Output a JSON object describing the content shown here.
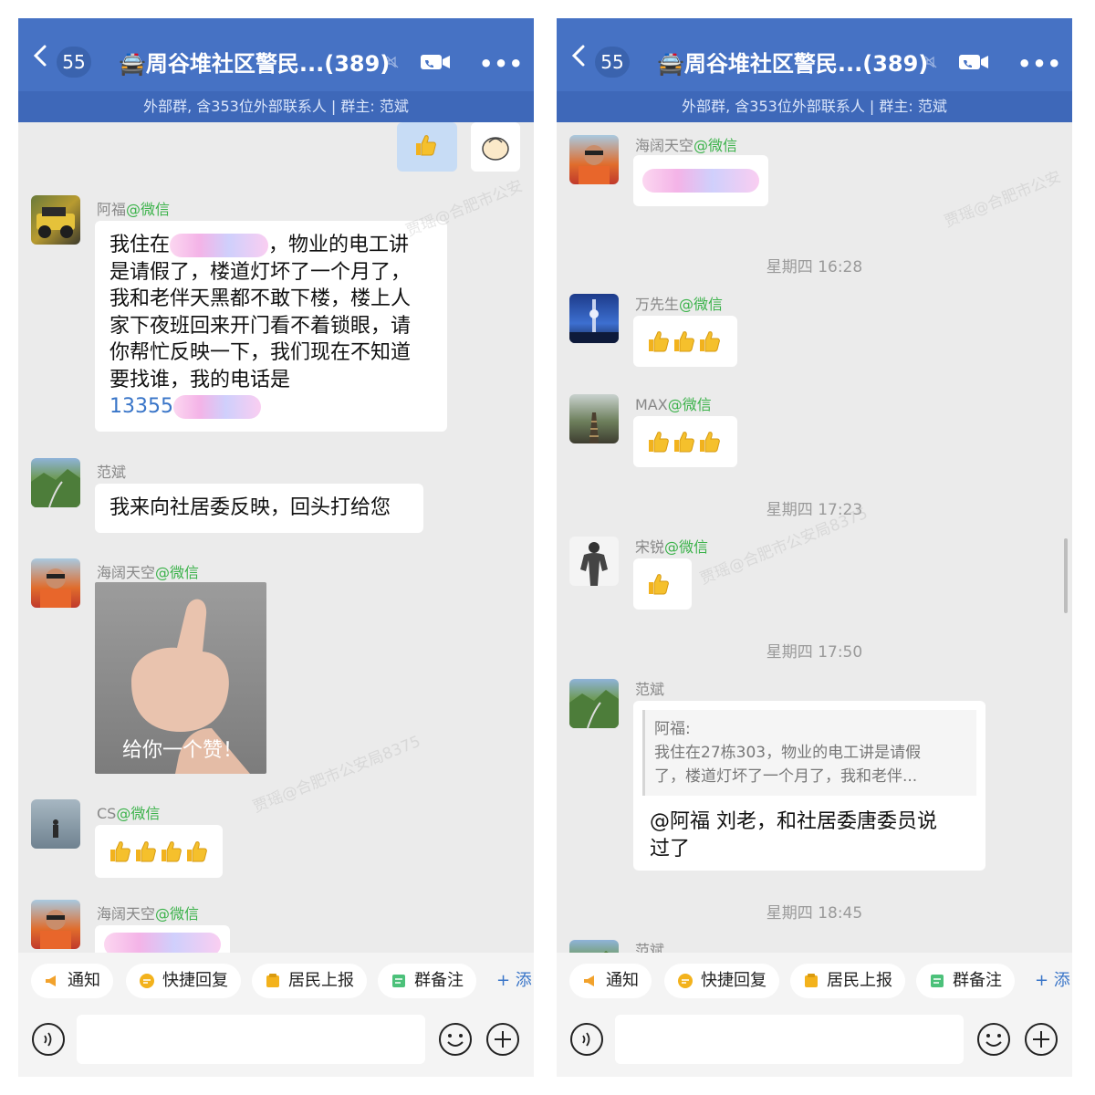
{
  "header": {
    "badge": "55",
    "title": "🚔周谷堆社区警民...(389)",
    "subtitle": "外部群, 含353位外部联系人 | 群主: 范斌"
  },
  "wechat_suffix": "@微信",
  "left": {
    "m1": {
      "sender": "阿福"
    },
    "m1_text": {
      "l1a": "我住在",
      "l1b": "，物业的电工讲",
      "l2": "是请假了，楼道灯坏了一个月了，",
      "l3": "我和老伴天黑都不敢下楼，楼上人",
      "l4": "家下夜班回来开门看不着锁眼，请",
      "l5": "你帮忙反映一下，我们现在不知道",
      "l6": "要找谁，我的电话是",
      "phone": "13355"
    },
    "m2": {
      "sender": "范斌",
      "text": "我来向社居委反映，回头打给您"
    },
    "m3": {
      "sender": "海阔天空",
      "image_caption": "给你一个赞！"
    },
    "m4": {
      "sender": "CS"
    },
    "m5": {
      "sender": "海阔天空"
    }
  },
  "right": {
    "m1": {
      "sender": "海阔天空"
    },
    "t1": "星期四 16:28",
    "m2": {
      "sender": "万先生"
    },
    "m3": {
      "sender": "MAX"
    },
    "t2": "星期四 17:23",
    "m4": {
      "sender": "宋锐"
    },
    "t3": "星期四 17:50",
    "m5": {
      "sender": "范斌",
      "quote_name": "阿福:",
      "quote_l1": "我住在27栋303，物业的电工讲是请假",
      "quote_l2": "了，楼道灯坏了一个月了，我和老伴...",
      "reply_l1": "@阿福 刘老，和社居委唐委员说",
      "reply_l2": "过了"
    },
    "t4": "星期四 18:45",
    "m6": {
      "sender": "范斌"
    }
  },
  "toolbar": {
    "notify": "通知",
    "quick_reply": "快捷回复",
    "resident_report": "居民上报",
    "group_note": "群备注",
    "add": "+ 添"
  },
  "colors": {
    "nav": "#4672c4",
    "subbar": "#3e68b9",
    "chat_bg": "#ebebeb",
    "wechat_green": "#3bb24a",
    "link_blue": "#3975c8"
  }
}
